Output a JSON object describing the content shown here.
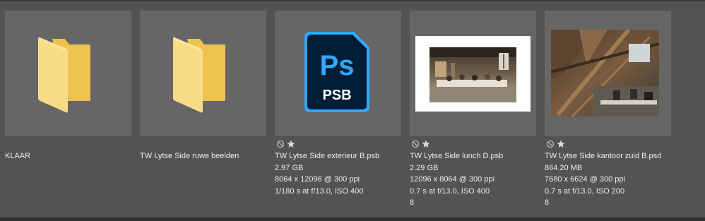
{
  "colors": {
    "background": "#535353",
    "tile": "#666666",
    "folder": "#f5d77c",
    "ps_blue": "#31a8ff",
    "ps_dark": "#001e36"
  },
  "items": [
    {
      "type": "folder",
      "icon": "folder-icon",
      "name": "KLAAR"
    },
    {
      "type": "folder",
      "icon": "folder-icon",
      "name": "TW Lytse Side ruwe beelden"
    },
    {
      "type": "psb",
      "icon": "photoshop-psb-icon",
      "icon_text_top": "Ps",
      "icon_text_bottom": "PSB",
      "name": "TW Lytse Side exterieur B.psb",
      "size": "2.97 GB",
      "dimensions": "8064 x 12096 @ 300 ppi",
      "exposure": "1/180 s at f/13.0, ISO 400"
    },
    {
      "type": "photo",
      "icon": "photo-thumbnail",
      "name": "TW Lytse Side lunch D.psb",
      "size": "2.29 GB",
      "dimensions": "12096 x 8064 @ 300 ppi",
      "exposure": "0.7 s at f/13.0, ISO 400",
      "extra": "8"
    },
    {
      "type": "photo",
      "icon": "photo-thumbnail",
      "name": "TW Lytse Side kantoor zuid B.psd",
      "size": "864.20 MB",
      "dimensions": "7680 x 6624 @ 300 ppi",
      "exposure": "0.7 s at f/13.0, ISO 200",
      "extra": "8"
    }
  ]
}
